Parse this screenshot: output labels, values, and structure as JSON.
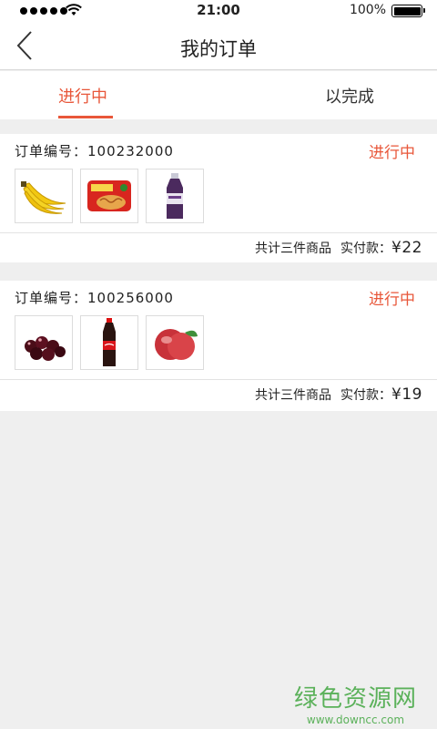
{
  "status_bar": {
    "time": "21:00",
    "battery": "100%"
  },
  "nav": {
    "title": "我的订单"
  },
  "tabs": [
    {
      "label": "进行中",
      "active": true
    },
    {
      "label": "以完成",
      "active": false
    }
  ],
  "orders": [
    {
      "number_label": "订单编号：",
      "number": "100232000",
      "status": "进行中",
      "items": [
        "banana",
        "instant-noodles",
        "purple-bottle-drink"
      ],
      "count_text": "共计三件商品",
      "paid_label": "实付款：",
      "amount": "¥22"
    },
    {
      "number_label": "订单编号：",
      "number": "100256000",
      "status": "进行中",
      "items": [
        "cherries",
        "cola-bottle",
        "red-fruit"
      ],
      "count_text": "共计三件商品",
      "paid_label": "实付款：",
      "amount": "¥19"
    }
  ],
  "watermark": {
    "main": "绿色资源网",
    "sub": "www.downcc.com"
  },
  "colors": {
    "accent": "#e8573a",
    "watermark": "#5bb15a",
    "background": "#efefef"
  }
}
